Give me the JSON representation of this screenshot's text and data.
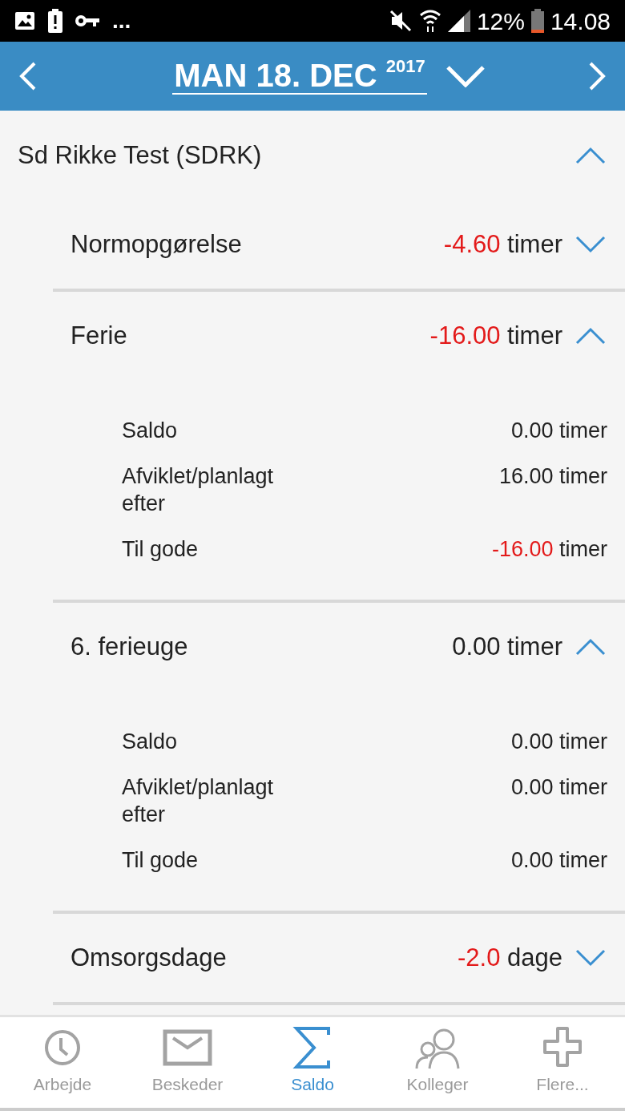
{
  "status_bar": {
    "overflow": "...",
    "battery": "12%",
    "time": "14.08"
  },
  "header": {
    "date": "MAN 18. DEC",
    "year": "2017"
  },
  "account": {
    "title": "Sd Rikke Test (SDRK)",
    "expanded": true
  },
  "balances": [
    {
      "name": "Normopgørelse",
      "value": "-4.60",
      "unit": "timer",
      "negative": true,
      "expanded": false
    },
    {
      "name": "Ferie",
      "value": "-16.00",
      "unit": "timer",
      "negative": true,
      "expanded": true,
      "details": [
        {
          "label": "Saldo",
          "value": "0.00",
          "unit": "timer",
          "negative": false
        },
        {
          "label": "Afviklet/planlagt efter",
          "value": "16.00",
          "unit": "timer",
          "negative": false
        },
        {
          "label": "Til gode",
          "value": "-16.00",
          "unit": "timer",
          "negative": true
        }
      ]
    },
    {
      "name": "6. ferieuge",
      "value": "0.00",
      "unit": "timer",
      "negative": false,
      "expanded": true,
      "details": [
        {
          "label": "Saldo",
          "value": "0.00",
          "unit": "timer",
          "negative": false
        },
        {
          "label": "Afviklet/planlagt efter",
          "value": "0.00",
          "unit": "timer",
          "negative": false
        },
        {
          "label": "Til gode",
          "value": "0.00",
          "unit": "timer",
          "negative": false
        }
      ]
    },
    {
      "name": "Omsorgsdage",
      "value": "-2.0",
      "unit": "dage",
      "negative": true,
      "expanded": false
    }
  ],
  "nav": [
    {
      "kind": "clock",
      "label": "Arbejde",
      "selected": false
    },
    {
      "kind": "mail",
      "label": "Beskeder",
      "selected": false
    },
    {
      "kind": "sigma",
      "label": "Saldo",
      "selected": true
    },
    {
      "kind": "people",
      "label": "Kolleger",
      "selected": false
    },
    {
      "kind": "plus",
      "label": "Flere...",
      "selected": false
    }
  ]
}
